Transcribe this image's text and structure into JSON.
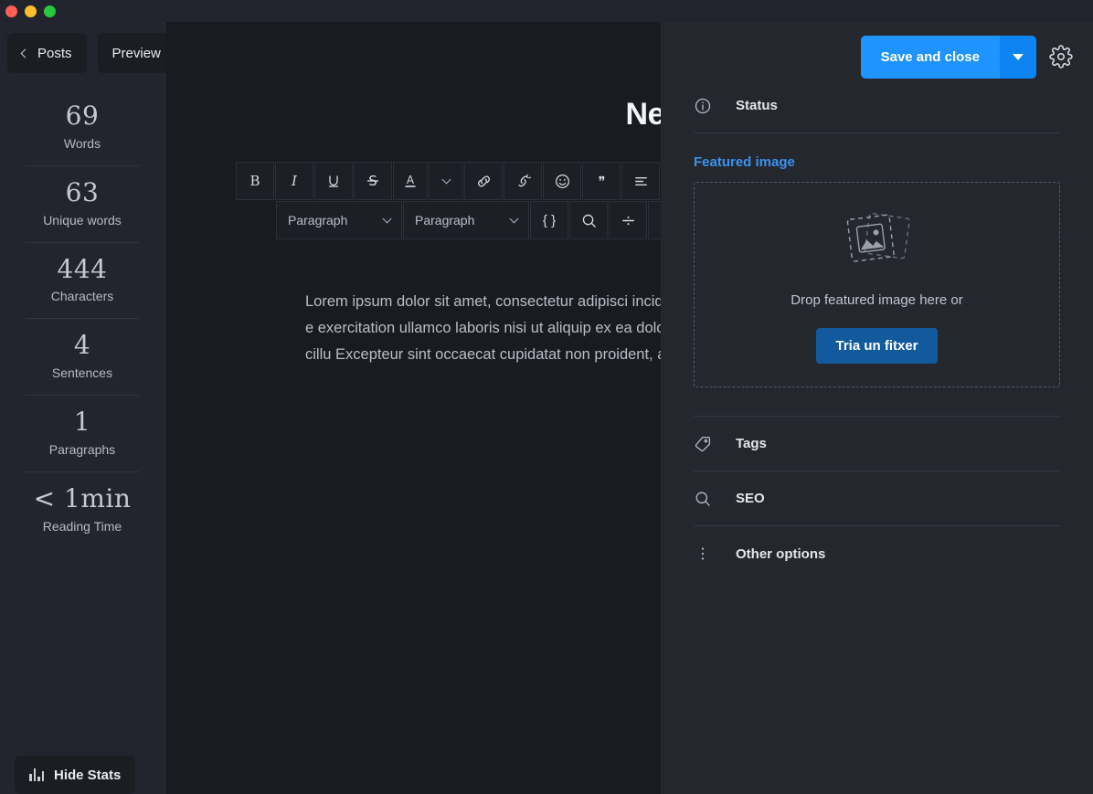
{
  "window": {
    "traffic_lights": [
      "close",
      "minimize",
      "maximize"
    ]
  },
  "sidebar": {
    "back_label": "Posts",
    "preview_label": "Preview",
    "stats": [
      {
        "value": "69",
        "label": "Words"
      },
      {
        "value": "63",
        "label": "Unique words"
      },
      {
        "value": "444",
        "label": "Characters"
      },
      {
        "value": "4",
        "label": "Sentences"
      },
      {
        "value": "1",
        "label": "Paragraphs"
      },
      {
        "value": "< 1min",
        "label": "Reading Time"
      }
    ],
    "hide_stats_label": "Hide Stats"
  },
  "editor": {
    "title": "New Post'",
    "body": "Lorem ipsum dolor sit amet, consectetur adipisci incididunt ut labore et dolore magna aliqua. Ut e exercitation ullamco laboris nisi ut aliquip ex ea dolor in reprehenderit in voluptate velit esse cillu Excepteur sint occaecat cupidatat non proident, anim id est laborum.",
    "toolbar_row1": [
      {
        "icon": "bold-icon",
        "label": "B"
      },
      {
        "icon": "italic-icon",
        "label": "I"
      },
      {
        "icon": "underline-icon",
        "label": "U"
      },
      {
        "icon": "strikethrough-icon",
        "label": "S"
      },
      {
        "icon": "text-color-icon",
        "label": "A"
      },
      {
        "icon": "link-icon",
        "label": ""
      },
      {
        "icon": "unlink-icon",
        "label": ""
      },
      {
        "icon": "emoji-icon",
        "label": ""
      },
      {
        "icon": "blockquote-icon",
        "label": ""
      },
      {
        "icon": "align-left-icon",
        "label": ""
      },
      {
        "icon": "align-center-icon",
        "label": ""
      }
    ],
    "toolbar_row2": {
      "format_select_1": "Paragraph",
      "format_select_2": "Paragraph",
      "code_block_label": "{ }",
      "find_icon": "search-icon",
      "divider_icon": "horizontal-rule-icon"
    }
  },
  "panel": {
    "save_label": "Save and close",
    "save_dropdown_icon": "chevron-down-icon",
    "settings_icon": "gear-icon",
    "status": {
      "label": "Status",
      "icon": "info-circle-icon"
    },
    "featured_image": {
      "heading": "Featured image",
      "drop_text": "Drop featured image here or",
      "choose_button": "Tria un fitxer",
      "placeholder_icon": "image-placeholder-icon"
    },
    "sections": [
      {
        "label": "Tags",
        "icon": "tag-icon"
      },
      {
        "label": "SEO",
        "icon": "search-icon"
      },
      {
        "label": "Other options",
        "icon": "kebab-menu-icon"
      }
    ]
  },
  "colors": {
    "accent_blue": "#1f93ff",
    "accent_blue_dark": "#0d84f2",
    "link_blue": "#3b92f0",
    "choose_button": "#125a9c",
    "editor_bg": "#191b21",
    "panel_bg": "#24272e",
    "sidebar_bg": "#22252d"
  }
}
